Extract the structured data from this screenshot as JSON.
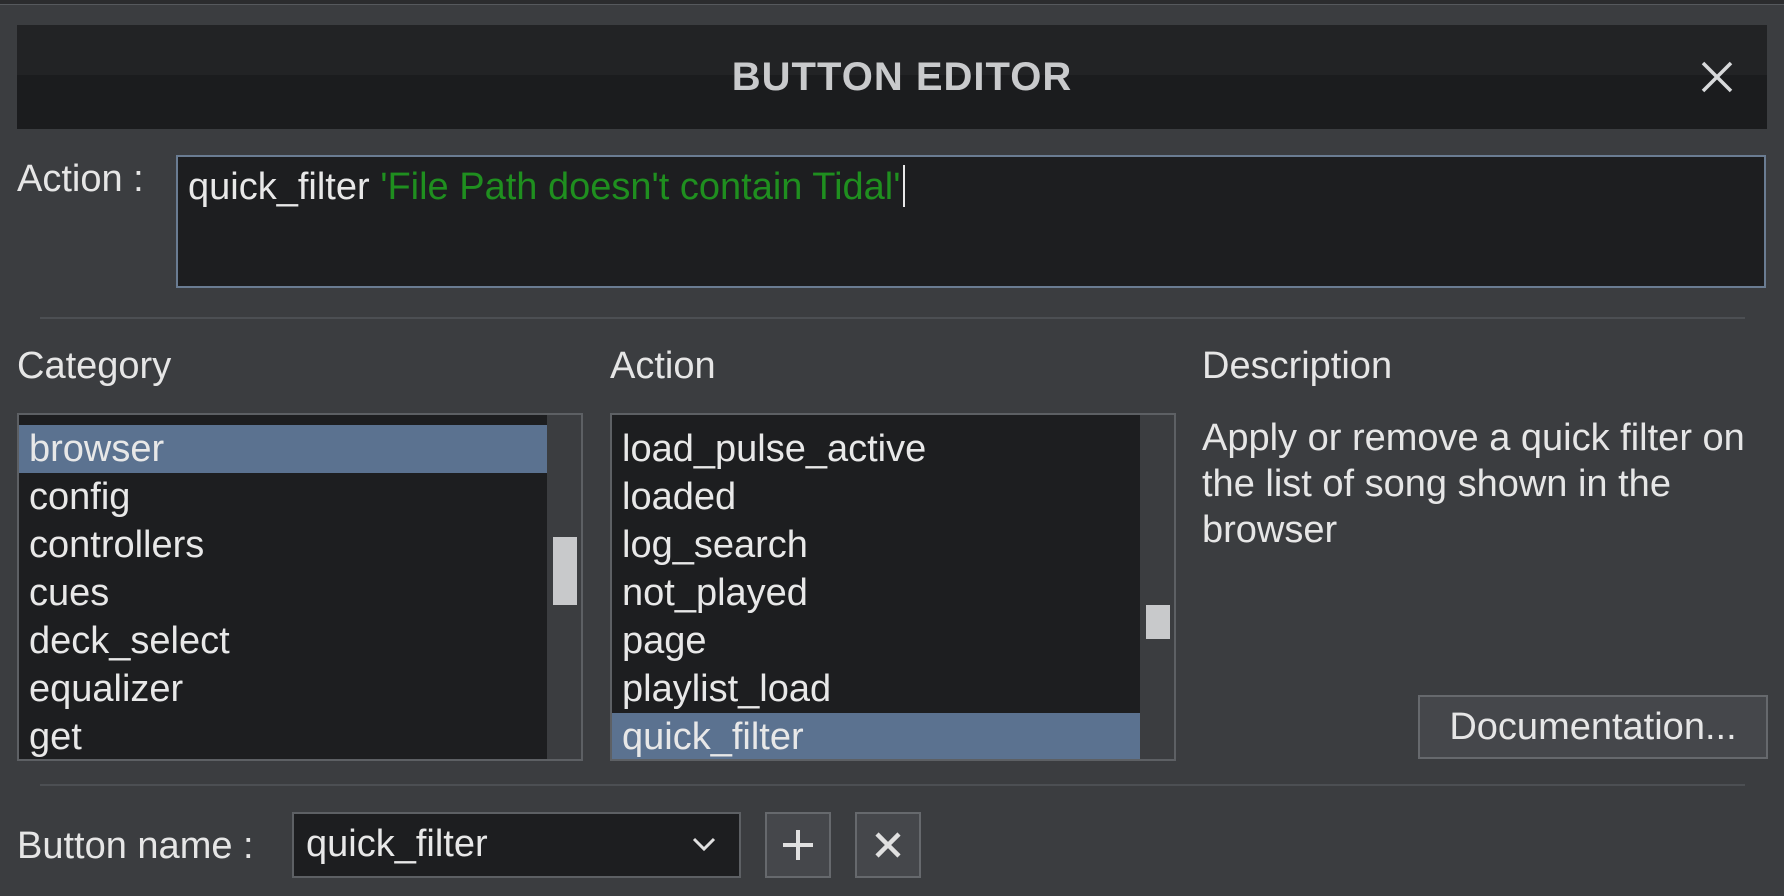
{
  "dialog": {
    "title": "BUTTON EDITOR",
    "close_icon": "close-icon"
  },
  "action_field": {
    "label": "Action :",
    "command": "quick_filter",
    "argument": "'File Path doesn't contain Tidal'"
  },
  "category": {
    "label": "Category",
    "items": [
      "browser",
      "config",
      "controllers",
      "cues",
      "deck_select",
      "equalizer",
      "get"
    ],
    "selected": "browser",
    "scroll_position": 0.35
  },
  "action_list": {
    "label": "Action",
    "items": [
      "load_pulse_active",
      "loaded",
      "log_search",
      "not_played",
      "page",
      "playlist_load",
      "quick_filter"
    ],
    "selected": "quick_filter",
    "scroll_position": 0.58
  },
  "description": {
    "label": "Description",
    "text": "Apply or remove a quick filter on the list of song shown in the browser",
    "documentation_button": "Documentation..."
  },
  "button_name": {
    "label": "Button name :",
    "value": "quick_filter",
    "add_icon": "plus-icon",
    "delete_icon": "close-icon"
  },
  "colors": {
    "background": "#3b3d40",
    "field_background": "#1d1e20",
    "selection": "#5b7290",
    "string_literal": "#1f8f1f"
  }
}
